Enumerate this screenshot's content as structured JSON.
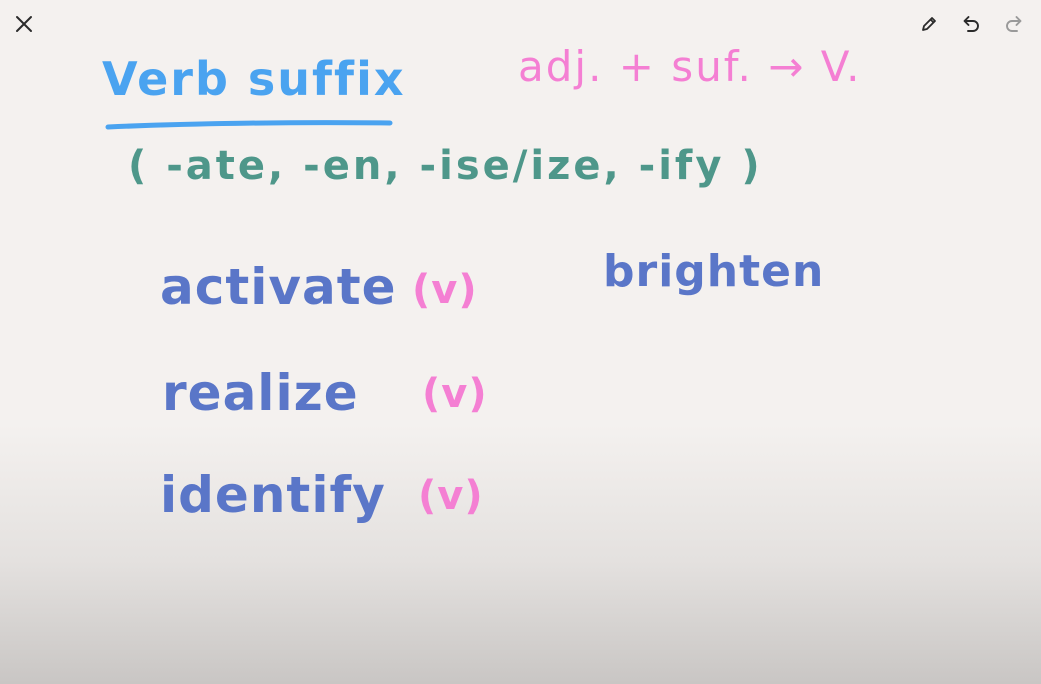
{
  "toolbar": {
    "close_icon": "close-icon",
    "pen_icon": "pencil-icon",
    "undo_icon": "undo-icon",
    "redo_icon": "redo-icon"
  },
  "colors": {
    "title_blue": "#4aa3f0",
    "teal": "#4e978a",
    "pink": "#f47fd3",
    "word_blue": "#5a76c8"
  },
  "board": {
    "title": "Verb suffix",
    "formula": "adj. + suf. → V.",
    "suffixes": "( -ate, -en, -ise/ize, -ify )",
    "examples": [
      {
        "word": "activate",
        "tag": "(v)"
      },
      {
        "word": "realize",
        "tag": "(v)"
      },
      {
        "word": "identify",
        "tag": "(v)"
      }
    ],
    "extra_word": "brighten"
  }
}
